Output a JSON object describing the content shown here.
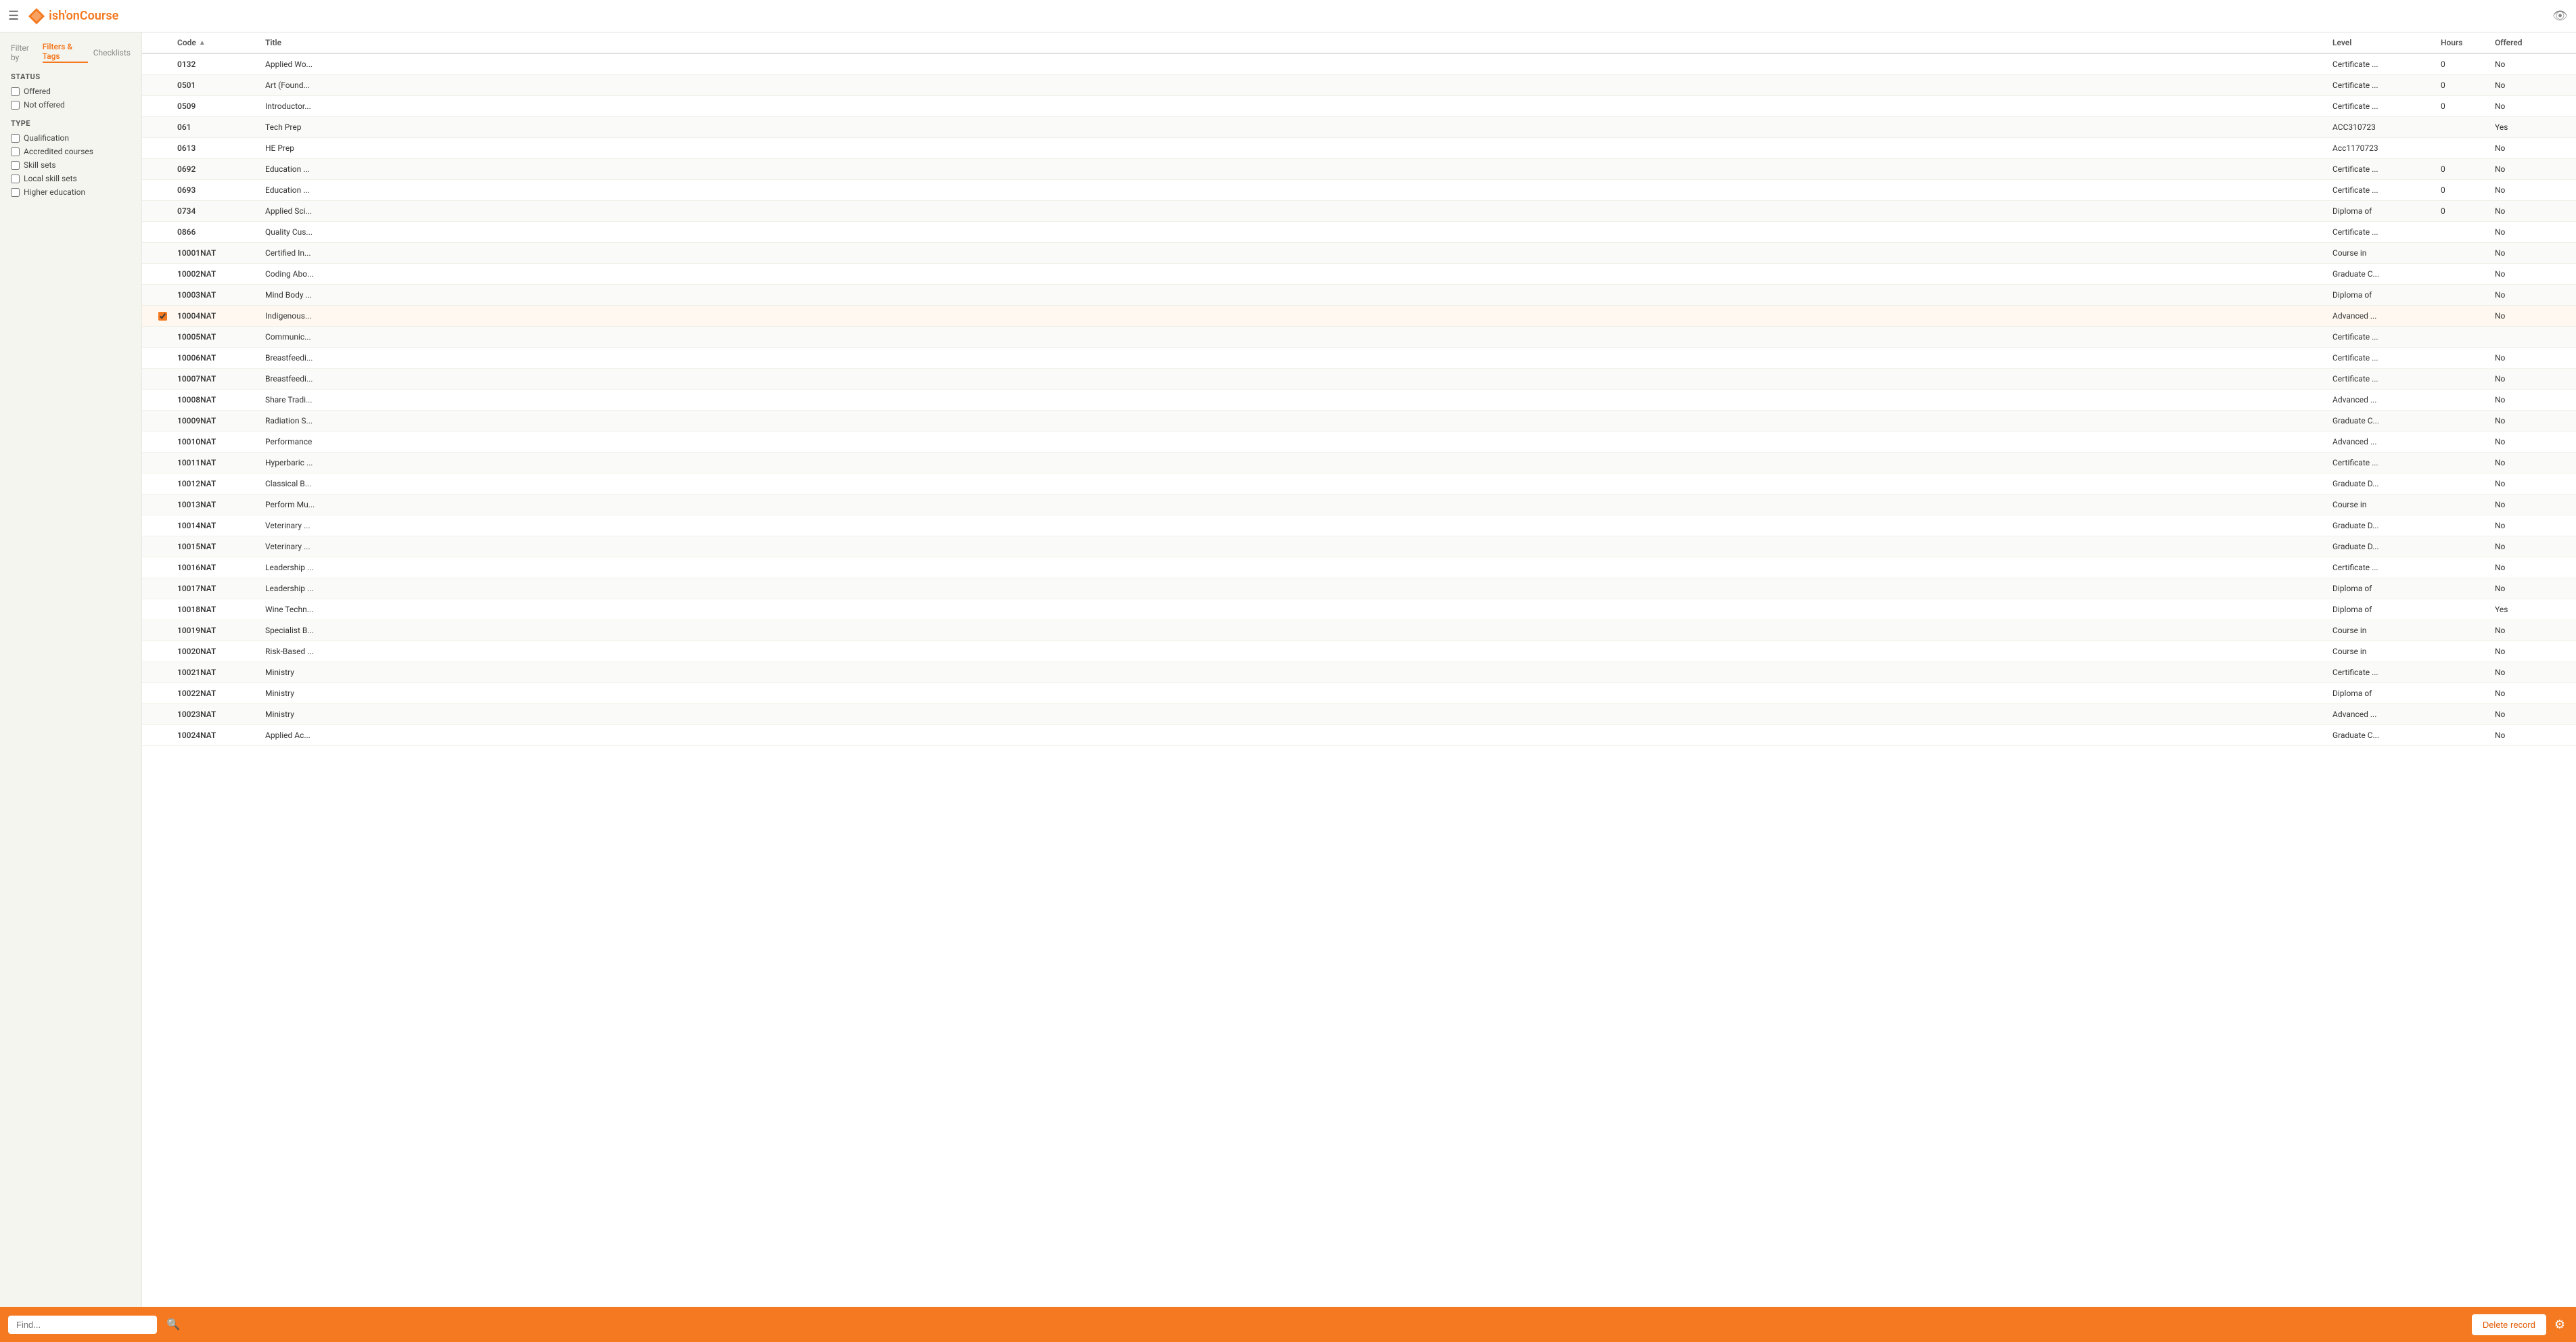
{
  "header": {
    "menu_icon": "☰",
    "logo_text_prefix": "ish",
    "logo_text_suffix": "'onCourse",
    "eye_icon": "👁"
  },
  "sidebar": {
    "filter_label": "Filter by",
    "tab_filters_tags": "Filters & Tags",
    "tab_checklists": "Checklists",
    "status_section": "STATUS",
    "status_options": [
      {
        "label": "Offered",
        "checked": false
      },
      {
        "label": "Not offered",
        "checked": false
      }
    ],
    "type_section": "TYPE",
    "type_options": [
      {
        "label": "Qualification",
        "checked": false
      },
      {
        "label": "Accredited courses",
        "checked": false
      },
      {
        "label": "Skill sets",
        "checked": false
      },
      {
        "label": "Local skill sets",
        "checked": false
      },
      {
        "label": "Higher education",
        "checked": false
      }
    ]
  },
  "table": {
    "columns": [
      {
        "key": "checkbox",
        "label": ""
      },
      {
        "key": "code",
        "label": "Code",
        "sortable": true,
        "sort_dir": "asc"
      },
      {
        "key": "title",
        "label": "Title"
      },
      {
        "key": "level",
        "label": "Level"
      },
      {
        "key": "hours",
        "label": "Hours"
      },
      {
        "key": "offered",
        "label": "Offered"
      }
    ],
    "rows": [
      {
        "code": "0132",
        "title": "Applied Wo...",
        "level": "Certificate ...",
        "hours": "0",
        "offered": "No",
        "selected": false
      },
      {
        "code": "0501",
        "title": "Art (Found...",
        "level": "Certificate ...",
        "hours": "0",
        "offered": "No",
        "selected": false
      },
      {
        "code": "0509",
        "title": "Introductor...",
        "level": "Certificate ...",
        "hours": "0",
        "offered": "No",
        "selected": false
      },
      {
        "code": "061",
        "title": "Tech Prep",
        "level": "ACC310723",
        "hours": "",
        "offered": "Yes",
        "selected": false
      },
      {
        "code": "0613",
        "title": "HE Prep",
        "level": "Acc1170723",
        "hours": "",
        "offered": "No",
        "selected": false
      },
      {
        "code": "0692",
        "title": "Education ...",
        "level": "Certificate ...",
        "hours": "0",
        "offered": "No",
        "selected": false
      },
      {
        "code": "0693",
        "title": "Education ...",
        "level": "Certificate ...",
        "hours": "0",
        "offered": "No",
        "selected": false
      },
      {
        "code": "0734",
        "title": "Applied Sci...",
        "level": "Diploma of",
        "hours": "0",
        "offered": "No",
        "selected": false
      },
      {
        "code": "0866",
        "title": "Quality Cus...",
        "level": "Certificate ...",
        "hours": "",
        "offered": "No",
        "selected": false
      },
      {
        "code": "10001NAT",
        "title": "Certified In...",
        "level": "Course in",
        "hours": "",
        "offered": "No",
        "selected": false
      },
      {
        "code": "10002NAT",
        "title": "Coding Abo...",
        "level": "Graduate C...",
        "hours": "",
        "offered": "No",
        "selected": false
      },
      {
        "code": "10003NAT",
        "title": "Mind Body ...",
        "level": "Diploma of",
        "hours": "",
        "offered": "No",
        "selected": false
      },
      {
        "code": "10004NAT",
        "title": "Indigenous...",
        "level": "Advanced ...",
        "hours": "",
        "offered": "No",
        "selected": true
      },
      {
        "code": "10005NAT",
        "title": "Communic...",
        "level": "Certificate ...",
        "hours": "",
        "offered": "",
        "selected": false
      },
      {
        "code": "10006NAT",
        "title": "Breastfeedi...",
        "level": "Certificate ...",
        "hours": "",
        "offered": "No",
        "selected": false
      },
      {
        "code": "10007NAT",
        "title": "Breastfeedi...",
        "level": "Certificate ...",
        "hours": "",
        "offered": "No",
        "selected": false
      },
      {
        "code": "10008NAT",
        "title": "Share Tradi...",
        "level": "Advanced ...",
        "hours": "",
        "offered": "No",
        "selected": false
      },
      {
        "code": "10009NAT",
        "title": "Radiation S...",
        "level": "Graduate C...",
        "hours": "",
        "offered": "No",
        "selected": false
      },
      {
        "code": "10010NAT",
        "title": "Performance",
        "level": "Advanced ...",
        "hours": "",
        "offered": "No",
        "selected": false
      },
      {
        "code": "10011NAT",
        "title": "Hyperbaric ...",
        "level": "Certificate ...",
        "hours": "",
        "offered": "No",
        "selected": false
      },
      {
        "code": "10012NAT",
        "title": "Classical B...",
        "level": "Graduate D...",
        "hours": "",
        "offered": "No",
        "selected": false
      },
      {
        "code": "10013NAT",
        "title": "Perform Mu...",
        "level": "Course in",
        "hours": "",
        "offered": "No",
        "selected": false
      },
      {
        "code": "10014NAT",
        "title": "Veterinary ...",
        "level": "Graduate D...",
        "hours": "",
        "offered": "No",
        "selected": false
      },
      {
        "code": "10015NAT",
        "title": "Veterinary ...",
        "level": "Graduate D...",
        "hours": "",
        "offered": "No",
        "selected": false
      },
      {
        "code": "10016NAT",
        "title": "Leadership ...",
        "level": "Certificate ...",
        "hours": "",
        "offered": "No",
        "selected": false
      },
      {
        "code": "10017NAT",
        "title": "Leadership ...",
        "level": "Diploma of",
        "hours": "",
        "offered": "No",
        "selected": false
      },
      {
        "code": "10018NAT",
        "title": "Wine Techn...",
        "level": "Diploma of",
        "hours": "",
        "offered": "Yes",
        "selected": false
      },
      {
        "code": "10019NAT",
        "title": "Specialist B...",
        "level": "Course in",
        "hours": "",
        "offered": "No",
        "selected": false
      },
      {
        "code": "10020NAT",
        "title": "Risk-Based ...",
        "level": "Course in",
        "hours": "",
        "offered": "No",
        "selected": false
      },
      {
        "code": "10021NAT",
        "title": "Ministry",
        "level": "Certificate ...",
        "hours": "",
        "offered": "No",
        "selected": false
      },
      {
        "code": "10022NAT",
        "title": "Ministry",
        "level": "Diploma of",
        "hours": "",
        "offered": "No",
        "selected": false
      },
      {
        "code": "10023NAT",
        "title": "Ministry",
        "level": "Advanced ...",
        "hours": "",
        "offered": "No",
        "selected": false
      },
      {
        "code": "10024NAT",
        "title": "Applied Ac...",
        "level": "Graduate C...",
        "hours": "",
        "offered": "No",
        "selected": false
      }
    ]
  },
  "bottom_bar": {
    "find_placeholder": "Find...",
    "search_icon": "🔍",
    "delete_label": "Delete record",
    "gear_icon": "⚙"
  }
}
